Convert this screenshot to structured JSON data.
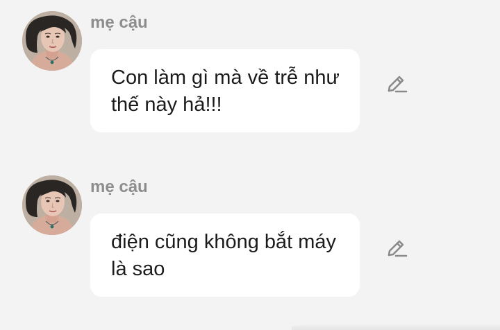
{
  "messages": [
    {
      "sender": "mẹ cậu",
      "avatar_icon": "woman-portrait-avatar",
      "text": "Con làm gì mà về trễ như thế này hả!!!",
      "edit_icon": "pencil-edit-icon"
    },
    {
      "sender": "mẹ cậu",
      "avatar_icon": "woman-portrait-avatar",
      "text": "điện cũng không bắt máy là sao",
      "edit_icon": "pencil-edit-icon"
    }
  ],
  "colors": {
    "background": "#f3f3f3",
    "bubble": "#ffffff",
    "sender_text": "#8d8d8d",
    "message_text": "#1b1b1b",
    "icon": "#8a8a8a"
  }
}
